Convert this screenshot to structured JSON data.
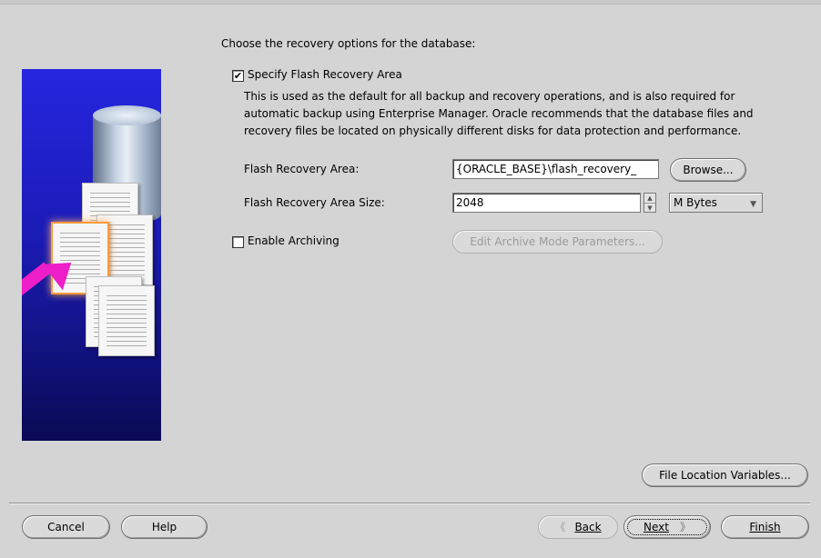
{
  "header": {
    "instruction": "Choose the recovery options for the database:"
  },
  "flash": {
    "checkbox_label": "Specify Flash Recovery Area",
    "checked": true,
    "description": "This is used as the default for all backup and recovery operations, and is also required for automatic backup using Enterprise Manager. Oracle recommends that the database files and recovery files be located on physically different disks for data protection and performance.",
    "area_label": "Flash Recovery Area:",
    "area_value": "{ORACLE_BASE}\\flash_recovery_",
    "browse_label": "Browse...",
    "size_label": "Flash Recovery Area Size:",
    "size_value": "2048",
    "unit_value": "M Bytes"
  },
  "archiving": {
    "checkbox_label": "Enable Archiving",
    "checked": false,
    "edit_params_label": "Edit Archive Mode Parameters..."
  },
  "file_location_variables_label": "File Location Variables...",
  "footer": {
    "cancel_label": "Cancel",
    "help_label": "Help",
    "back_label": "Back",
    "next_label": "Next",
    "finish_label": "Finish"
  },
  "icons": {
    "checkmark": "✔",
    "spin_up": "▲",
    "spin_down": "▼",
    "dropdown": "▼",
    "back_chevron": "《",
    "next_chevron": "》"
  },
  "colors": {
    "background": "#d4d4d4",
    "illustration_blue": "#1b1bb6",
    "arrow_magenta": "#ee1ec8"
  }
}
